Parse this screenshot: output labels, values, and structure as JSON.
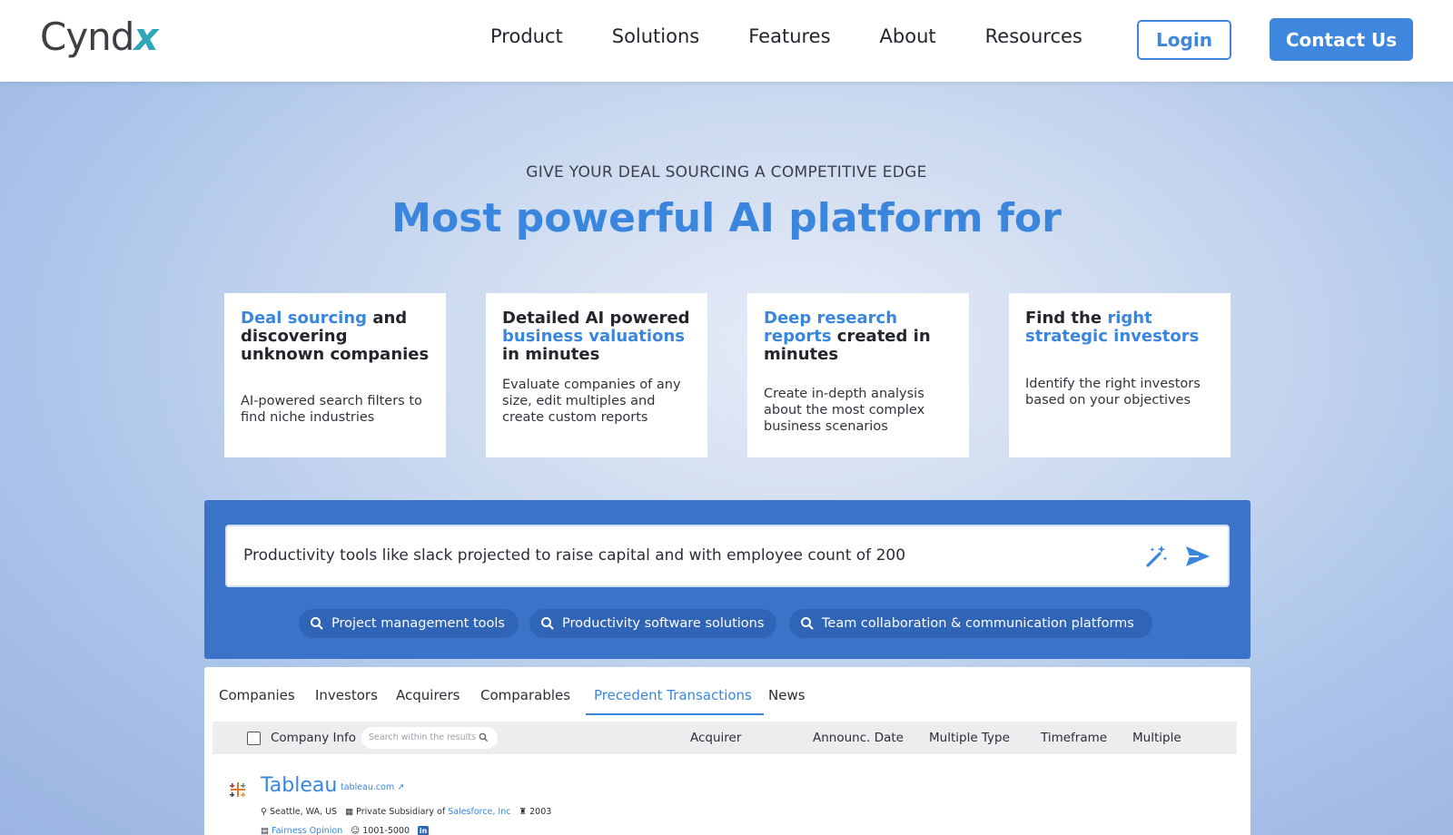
{
  "brand": {
    "name_main": "Cynd",
    "name_accent": "x"
  },
  "nav": {
    "items": [
      "Product",
      "Solutions",
      "Features",
      "About",
      "Resources"
    ],
    "login_label": "Login",
    "contact_label": "Contact Us"
  },
  "hero": {
    "eyebrow": "GIVE YOUR DEAL SOURCING A COMPETITIVE EDGE",
    "headline": "Most powerful AI platform for"
  },
  "cards": [
    {
      "title_hl1": "Deal sourcing",
      "title_rest": " and discovering unknown companies",
      "desc": "AI-powered search filters to find niche industries"
    },
    {
      "title_pre": "Detailed AI powered ",
      "title_hl": "business valuations",
      "title_post": " in minutes",
      "desc": "Evaluate companies of any size, edit multiples and create custom reports"
    },
    {
      "title_hl": "Deep research reports",
      "title_post": " created in minutes",
      "desc": "Create in-depth analysis about the most complex business scenarios"
    },
    {
      "title_pre": "Find the ",
      "title_hl": "right strategic investors",
      "desc": "Identify the right investors based on your objectives"
    }
  ],
  "search": {
    "query": "Productivity tools like slack projected to raise capital and with employee count of 200",
    "suggestions": [
      "Project management tools",
      "Productivity software solutions",
      "Team collaboration & communication platforms"
    ]
  },
  "results": {
    "tabs": [
      "Companies",
      "Investors",
      "Acquirers",
      "Comparables",
      "Precedent Transactions",
      "News"
    ],
    "active_tab": "Precedent Transactions",
    "columns": {
      "company": "Company Info",
      "search_placeholder": "Search within the results",
      "acquirer": "Acquirer",
      "date": "Announc. Date",
      "multiple_type": "Multiple Type",
      "timeframe": "Timeframe",
      "multiple": "Multiple"
    },
    "row": {
      "name": "Tableau",
      "site": "tableau.com",
      "location": "Seattle, WA, US",
      "ownership_pre": "Private Subsidiary of ",
      "parent": "Salesforce, Inc",
      "founded": "2003",
      "opinion": "Fairness Opinion",
      "employees": "1001-5000"
    }
  },
  "colors": {
    "accent": "#3a86de",
    "panel": "#3a73c8",
    "logo_accent": "#2fa7b9"
  }
}
